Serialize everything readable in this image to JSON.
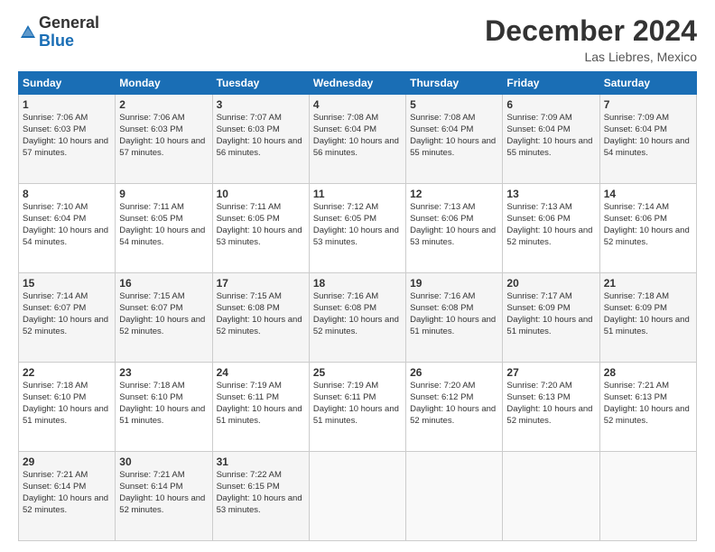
{
  "logo": {
    "general": "General",
    "blue": "Blue"
  },
  "title": "December 2024",
  "location": "Las Liebres, Mexico",
  "days_header": [
    "Sunday",
    "Monday",
    "Tuesday",
    "Wednesday",
    "Thursday",
    "Friday",
    "Saturday"
  ],
  "weeks": [
    [
      {
        "day": "1",
        "sunrise": "7:06 AM",
        "sunset": "6:03 PM",
        "daylight": "10 hours and 57 minutes."
      },
      {
        "day": "2",
        "sunrise": "7:06 AM",
        "sunset": "6:03 PM",
        "daylight": "10 hours and 57 minutes."
      },
      {
        "day": "3",
        "sunrise": "7:07 AM",
        "sunset": "6:03 PM",
        "daylight": "10 hours and 56 minutes."
      },
      {
        "day": "4",
        "sunrise": "7:08 AM",
        "sunset": "6:04 PM",
        "daylight": "10 hours and 56 minutes."
      },
      {
        "day": "5",
        "sunrise": "7:08 AM",
        "sunset": "6:04 PM",
        "daylight": "10 hours and 55 minutes."
      },
      {
        "day": "6",
        "sunrise": "7:09 AM",
        "sunset": "6:04 PM",
        "daylight": "10 hours and 55 minutes."
      },
      {
        "day": "7",
        "sunrise": "7:09 AM",
        "sunset": "6:04 PM",
        "daylight": "10 hours and 54 minutes."
      }
    ],
    [
      {
        "day": "8",
        "sunrise": "7:10 AM",
        "sunset": "6:04 PM",
        "daylight": "10 hours and 54 minutes."
      },
      {
        "day": "9",
        "sunrise": "7:11 AM",
        "sunset": "6:05 PM",
        "daylight": "10 hours and 54 minutes."
      },
      {
        "day": "10",
        "sunrise": "7:11 AM",
        "sunset": "6:05 PM",
        "daylight": "10 hours and 53 minutes."
      },
      {
        "day": "11",
        "sunrise": "7:12 AM",
        "sunset": "6:05 PM",
        "daylight": "10 hours and 53 minutes."
      },
      {
        "day": "12",
        "sunrise": "7:13 AM",
        "sunset": "6:06 PM",
        "daylight": "10 hours and 53 minutes."
      },
      {
        "day": "13",
        "sunrise": "7:13 AM",
        "sunset": "6:06 PM",
        "daylight": "10 hours and 52 minutes."
      },
      {
        "day": "14",
        "sunrise": "7:14 AM",
        "sunset": "6:06 PM",
        "daylight": "10 hours and 52 minutes."
      }
    ],
    [
      {
        "day": "15",
        "sunrise": "7:14 AM",
        "sunset": "6:07 PM",
        "daylight": "10 hours and 52 minutes."
      },
      {
        "day": "16",
        "sunrise": "7:15 AM",
        "sunset": "6:07 PM",
        "daylight": "10 hours and 52 minutes."
      },
      {
        "day": "17",
        "sunrise": "7:15 AM",
        "sunset": "6:08 PM",
        "daylight": "10 hours and 52 minutes."
      },
      {
        "day": "18",
        "sunrise": "7:16 AM",
        "sunset": "6:08 PM",
        "daylight": "10 hours and 52 minutes."
      },
      {
        "day": "19",
        "sunrise": "7:16 AM",
        "sunset": "6:08 PM",
        "daylight": "10 hours and 51 minutes."
      },
      {
        "day": "20",
        "sunrise": "7:17 AM",
        "sunset": "6:09 PM",
        "daylight": "10 hours and 51 minutes."
      },
      {
        "day": "21",
        "sunrise": "7:18 AM",
        "sunset": "6:09 PM",
        "daylight": "10 hours and 51 minutes."
      }
    ],
    [
      {
        "day": "22",
        "sunrise": "7:18 AM",
        "sunset": "6:10 PM",
        "daylight": "10 hours and 51 minutes."
      },
      {
        "day": "23",
        "sunrise": "7:18 AM",
        "sunset": "6:10 PM",
        "daylight": "10 hours and 51 minutes."
      },
      {
        "day": "24",
        "sunrise": "7:19 AM",
        "sunset": "6:11 PM",
        "daylight": "10 hours and 51 minutes."
      },
      {
        "day": "25",
        "sunrise": "7:19 AM",
        "sunset": "6:11 PM",
        "daylight": "10 hours and 51 minutes."
      },
      {
        "day": "26",
        "sunrise": "7:20 AM",
        "sunset": "6:12 PM",
        "daylight": "10 hours and 52 minutes."
      },
      {
        "day": "27",
        "sunrise": "7:20 AM",
        "sunset": "6:13 PM",
        "daylight": "10 hours and 52 minutes."
      },
      {
        "day": "28",
        "sunrise": "7:21 AM",
        "sunset": "6:13 PM",
        "daylight": "10 hours and 52 minutes."
      }
    ],
    [
      {
        "day": "29",
        "sunrise": "7:21 AM",
        "sunset": "6:14 PM",
        "daylight": "10 hours and 52 minutes."
      },
      {
        "day": "30",
        "sunrise": "7:21 AM",
        "sunset": "6:14 PM",
        "daylight": "10 hours and 52 minutes."
      },
      {
        "day": "31",
        "sunrise": "7:22 AM",
        "sunset": "6:15 PM",
        "daylight": "10 hours and 53 minutes."
      },
      null,
      null,
      null,
      null
    ]
  ],
  "labels": {
    "sunrise": "Sunrise:",
    "sunset": "Sunset:",
    "daylight": "Daylight:"
  }
}
